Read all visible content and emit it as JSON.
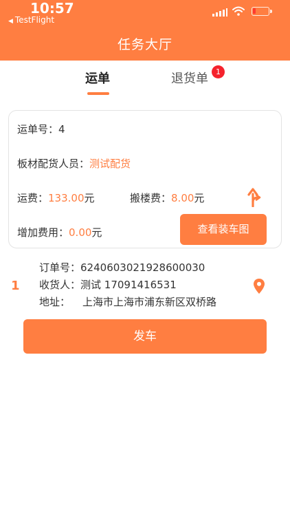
{
  "status_bar": {
    "time": "10:57",
    "back_app": "TestFlight",
    "back_icon": "triangle-left"
  },
  "header": {
    "title": "任务大厅"
  },
  "tabs": [
    {
      "label": "运单",
      "active": true
    },
    {
      "label": "退货单",
      "active": false,
      "badge": "1"
    }
  ],
  "waybill": {
    "number_label": "运单号：",
    "number": "4",
    "distributor_label": "板材配货人员：",
    "distributor": "测试配货",
    "freight_label": "运费：",
    "freight": "133.00",
    "freight_unit": "元",
    "stairs_label": "搬楼费：",
    "stairs_fee": "8.00",
    "stairs_unit": "元",
    "extra_label": "增加费用：",
    "extra_fee": "0.00",
    "extra_unit": "元",
    "view_loading_label": "查看装车图"
  },
  "order": {
    "index": "1",
    "order_no_label": "订单号：",
    "order_no": "6240603021928600030",
    "receiver_label": "收货人：",
    "receiver": "测试 17091416531",
    "address_label": "地址：",
    "address": "上海市上海市浦东新区双桥路"
  },
  "depart_label": "发车",
  "colors": {
    "accent": "#ff7e41",
    "badge": "#f5222d",
    "battery_low": "#ff3b30"
  }
}
